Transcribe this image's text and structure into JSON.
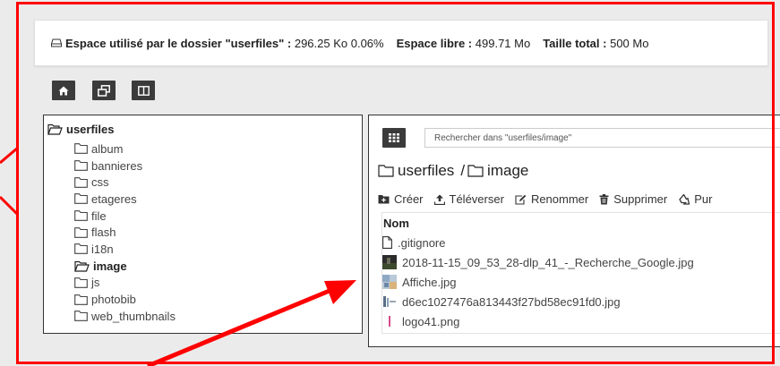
{
  "space_bar": {
    "used_label": "Espace utilisé par le dossier \"userfiles\" :",
    "used_value": "296.25 Ko 0.06%",
    "free_label": "Espace libre :",
    "free_value": "499.71 Mo",
    "total_label": "Taille total :",
    "total_value": "500 Mo"
  },
  "toolbar": [
    "home-icon",
    "window-restore-icon",
    "columns-icon"
  ],
  "tree": {
    "root": "userfiles",
    "folders": [
      "album",
      "bannieres",
      "css",
      "etageres",
      "file",
      "flash",
      "i18n",
      "image",
      "js",
      "photobib",
      "web_thumbnails"
    ],
    "active": "image"
  },
  "browser": {
    "search_placeholder": "Rechercher dans \"userfiles/image\"",
    "breadcrumb": [
      "userfiles",
      "image"
    ],
    "breadcrumb_sep": "/",
    "actions": [
      "Créer",
      "Téléverser",
      "Renommer",
      "Supprimer",
      "Pur"
    ],
    "column_header": "Nom",
    "files": [
      ".gitignore",
      "2018-11-15_09_53_28-dlp_41_-_Recherche_Google.jpg",
      "Affiche.jpg",
      "d6ec1027476a813443f27bd58ec91fd0.jpg",
      "logo41.png"
    ]
  },
  "colors": {
    "annotation": "#ff0000",
    "button_dark": "#3b3b3b",
    "background": "#ebebeb"
  }
}
